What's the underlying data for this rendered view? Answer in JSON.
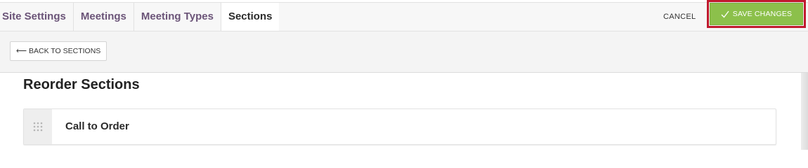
{
  "nav": {
    "tabs": [
      {
        "label": "Site Settings"
      },
      {
        "label": "Meetings"
      },
      {
        "label": "Meeting Types"
      },
      {
        "label": "Sections"
      }
    ],
    "cancel_label": "CANCEL",
    "save_label": "SAVE CHANGES"
  },
  "toolbar": {
    "back_label": "BACK TO SECTIONS",
    "back_icon": "arrow-left-icon"
  },
  "main": {
    "title": "Reorder Sections",
    "sections": [
      {
        "label": "Call to Order",
        "icon": "drag-handle-icon"
      }
    ]
  },
  "colors": {
    "tab_text": "#6b5478",
    "save_button": "#8cc04b",
    "highlight_border": "#c01a2e"
  }
}
